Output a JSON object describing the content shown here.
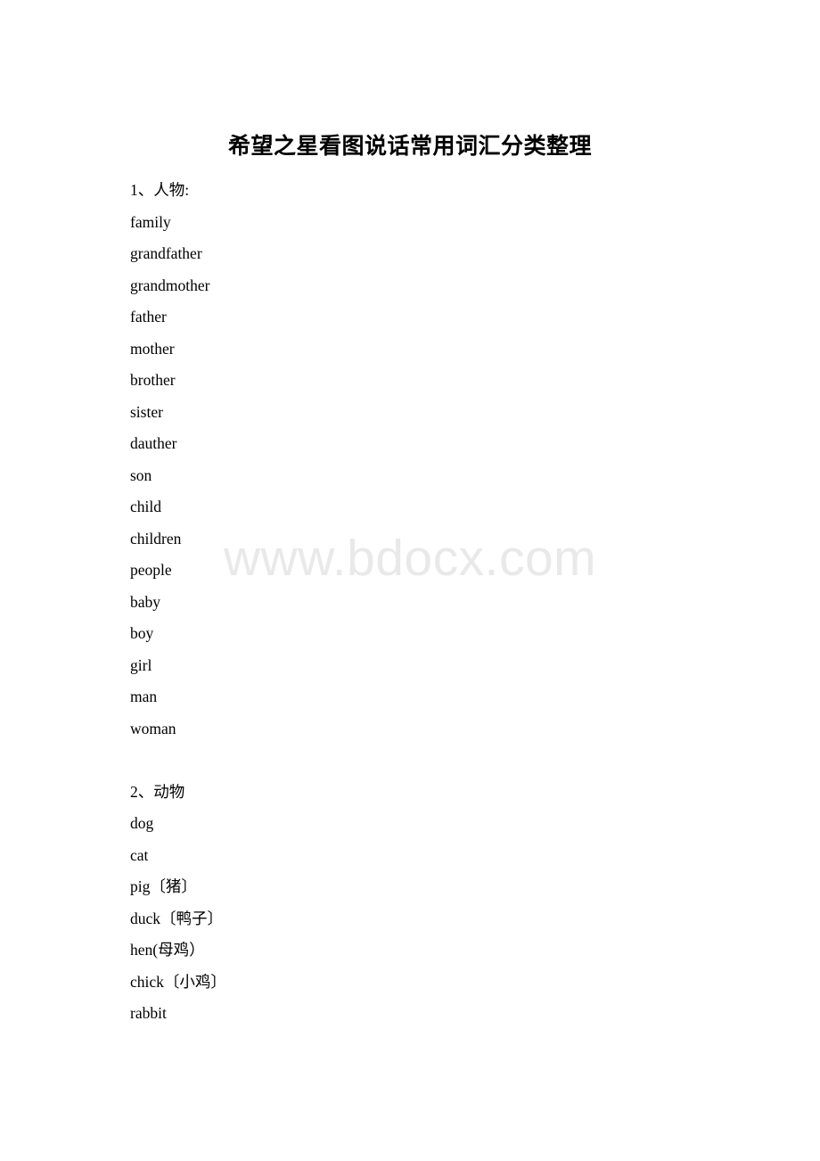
{
  "document": {
    "title": "希望之星看图说话常用词汇分类整理",
    "watermark": "www.bdocx.com",
    "sections": [
      {
        "heading": "1、人物:",
        "items": [
          "family",
          "grandfather",
          "grandmother",
          "father",
          "mother",
          "brother",
          "sister",
          "dauther",
          "son",
          "child",
          "children",
          "people",
          "baby",
          "boy",
          "girl",
          "man",
          "woman"
        ]
      },
      {
        "heading": "2、动物",
        "items": [
          "dog",
          "cat",
          "pig〔猪〕",
          "duck〔鸭子〕",
          "hen(母鸡）",
          "chick〔小鸡〕",
          "rabbit"
        ]
      }
    ]
  }
}
